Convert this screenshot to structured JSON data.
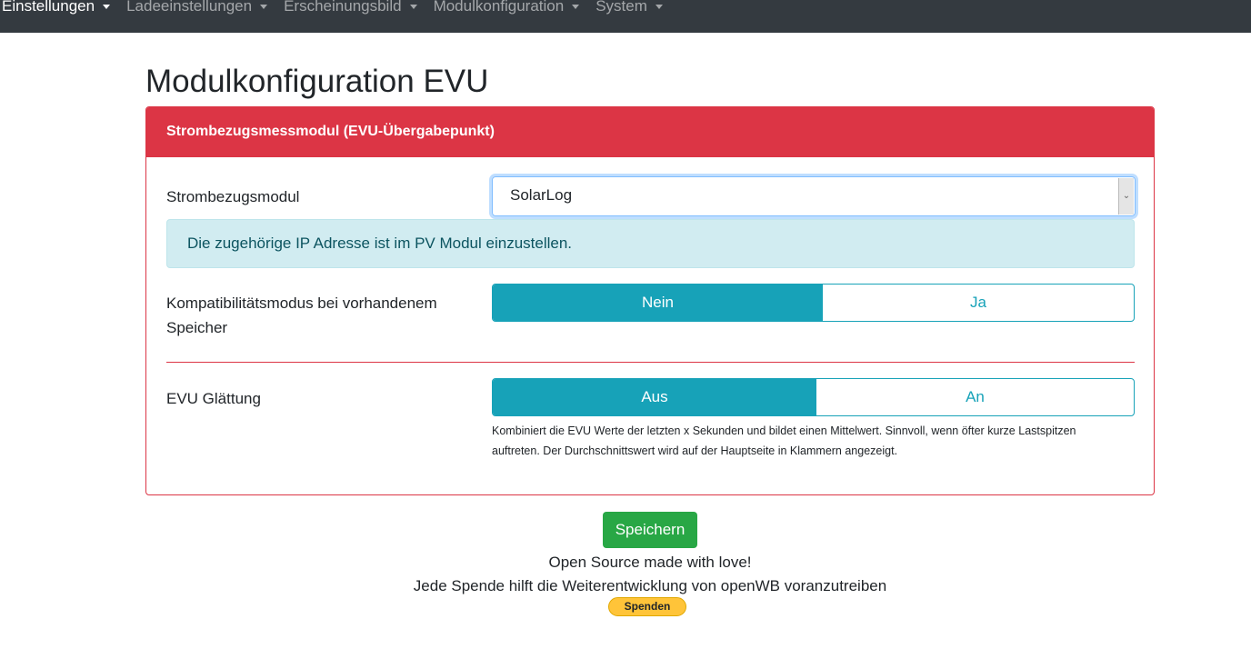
{
  "nav": {
    "items": [
      "Einstellungen",
      "Ladeeinstellungen",
      "Erscheinungsbild",
      "Modulkonfiguration",
      "System"
    ]
  },
  "page_title": "Modulkonfiguration EVU",
  "card": {
    "header": "Strombezugsmessmodul (EVU-Übergabepunkt)",
    "module_label": "Strombezugsmodul",
    "module_value": "SolarLog",
    "info": "Die zugehörige IP Adresse ist im PV Modul einzustellen.",
    "compat_label": "Kompatibilitätsmodus bei vorhandenem Speicher",
    "compat_options": [
      "Nein",
      "Ja"
    ],
    "smooth_label": "EVU Glättung",
    "smooth_options": [
      "Aus",
      "An"
    ],
    "smooth_help": "Kombiniert die EVU Werte der letzten x Sekunden und bildet einen Mittelwert. Sinnvoll, wenn öfter kurze Lastspitzen auftreten. Der Durchschnittswert wird auf der Hauptseite in Klammern angezeigt."
  },
  "save_label": "Speichern",
  "footer": {
    "line1": "Open Source made with love!",
    "line2": "Jede Spende hilft die Weiterentwicklung von openWB voranzutreiben",
    "donate": "Spenden"
  },
  "colors": {
    "danger": "#dc3545",
    "info": "#17a2b8",
    "success": "#28a745"
  }
}
